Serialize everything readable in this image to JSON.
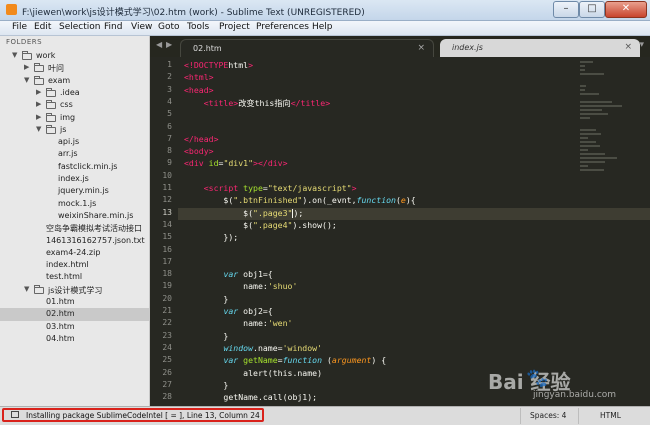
{
  "window": {
    "title": "F:\\jiewen\\work\\js设计模式学习\\02.htm (work) - Sublime Text (UNREGISTERED)",
    "min": "–",
    "max": "□",
    "close": "✕"
  },
  "menu": [
    "File",
    "Edit",
    "Selection",
    "Find",
    "View",
    "Goto",
    "Tools",
    "Project",
    "Preferences",
    "Help"
  ],
  "sidebar": {
    "header": "FOLDERS",
    "items": [
      {
        "label": "work",
        "type": "folder",
        "open": true,
        "depth": 0
      },
      {
        "label": "叶问",
        "type": "folder",
        "open": false,
        "depth": 1
      },
      {
        "label": "exam",
        "type": "folder",
        "open": true,
        "depth": 1
      },
      {
        "label": ".idea",
        "type": "folder",
        "open": false,
        "depth": 2
      },
      {
        "label": "css",
        "type": "folder",
        "open": false,
        "depth": 2
      },
      {
        "label": "img",
        "type": "folder",
        "open": false,
        "depth": 2
      },
      {
        "label": "js",
        "type": "folder",
        "open": true,
        "depth": 2
      },
      {
        "label": "api.js",
        "type": "file",
        "depth": 3
      },
      {
        "label": "arr.js",
        "type": "file",
        "depth": 3
      },
      {
        "label": "fastclick.min.js",
        "type": "file",
        "depth": 3
      },
      {
        "label": "index.js",
        "type": "file",
        "depth": 3
      },
      {
        "label": "jquery.min.js",
        "type": "file",
        "depth": 3
      },
      {
        "label": "mock.1.js",
        "type": "file",
        "depth": 3
      },
      {
        "label": "weixinShare.min.js",
        "type": "file",
        "depth": 3
      },
      {
        "label": "空岛争霸模拟考试活动接口",
        "type": "file",
        "depth": 2
      },
      {
        "label": "1461316162757.json.txt",
        "type": "file",
        "depth": 2
      },
      {
        "label": "exam4-24.zip",
        "type": "file",
        "depth": 2
      },
      {
        "label": "index.html",
        "type": "file",
        "depth": 2
      },
      {
        "label": "test.html",
        "type": "file",
        "depth": 2
      },
      {
        "label": "js设计模式学习",
        "type": "folder",
        "open": true,
        "depth": 1
      },
      {
        "label": "01.htm",
        "type": "file",
        "depth": 2
      },
      {
        "label": "02.htm",
        "type": "file",
        "depth": 2,
        "selected": true
      },
      {
        "label": "03.htm",
        "type": "file",
        "depth": 2
      },
      {
        "label": "04.htm",
        "type": "file",
        "depth": 2
      }
    ]
  },
  "tabs": [
    {
      "label": "02.htm",
      "active": true,
      "close": "×"
    },
    {
      "label": "index.js",
      "active": false,
      "close": "×"
    }
  ],
  "tab_nav": {
    "left": "◀",
    "right": "▶",
    "menu": "▾"
  },
  "editor": {
    "current_line": 13,
    "lines": [
      [
        [
          "k-tag",
          "<!DOCTYPE"
        ],
        [
          "",
          "html"
        ],
        [
          "k-tag",
          ">"
        ]
      ],
      [
        [
          "k-tag",
          "<html>"
        ]
      ],
      [
        [
          "k-tag",
          "<head>"
        ]
      ],
      [
        [
          "",
          "    "
        ],
        [
          "k-tag",
          "<title>"
        ],
        [
          "",
          "改变this指向"
        ],
        [
          "k-tag",
          "</title>"
        ]
      ],
      [],
      [],
      [
        [
          "k-tag",
          "</head>"
        ]
      ],
      [
        [
          "k-tag",
          "<body>"
        ]
      ],
      [
        [
          "k-tag",
          "<div "
        ],
        [
          "k-attr",
          "id"
        ],
        [
          "",
          "="
        ],
        [
          "k-str",
          "\"div1\""
        ],
        [
          "k-tag",
          "></div>"
        ]
      ],
      [],
      [
        [
          "",
          "    "
        ],
        [
          "k-tag",
          "<script "
        ],
        [
          "k-attr",
          "type"
        ],
        [
          "",
          "="
        ],
        [
          "k-str",
          "\"text/javascript\""
        ],
        [
          "k-tag",
          ">"
        ]
      ],
      [
        [
          "",
          "        $("
        ],
        [
          "k-str",
          "\".btnFinished\""
        ],
        [
          "",
          ").on(_evnt,"
        ],
        [
          "k-kw",
          "function"
        ],
        [
          "",
          "("
        ],
        [
          "k-var",
          "e"
        ],
        [
          "",
          "){"
        ]
      ],
      [
        [
          "",
          "            $("
        ],
        [
          "k-str",
          "\".page3\""
        ],
        [
          "",
          ");"
        ]
      ],
      [
        [
          "",
          "            $("
        ],
        [
          "k-str",
          "\".page4\""
        ],
        [
          "",
          ").show();"
        ]
      ],
      [
        [
          "",
          "        });"
        ]
      ],
      [],
      [],
      [
        [
          "",
          "        "
        ],
        [
          "k-kw",
          "var "
        ],
        [
          "",
          "obj1={"
        ]
      ],
      [
        [
          "",
          "            name:"
        ],
        [
          "k-str",
          "'shuo'"
        ]
      ],
      [
        [
          "",
          "        }"
        ]
      ],
      [
        [
          "",
          "        "
        ],
        [
          "k-kw",
          "var "
        ],
        [
          "",
          "obj2={"
        ]
      ],
      [
        [
          "",
          "            name:"
        ],
        [
          "k-str",
          "'wen'"
        ]
      ],
      [
        [
          "",
          "        }"
        ]
      ],
      [
        [
          "",
          "        "
        ],
        [
          "k-kw",
          "window"
        ],
        [
          "",
          ".name="
        ],
        [
          "k-str",
          "'window'"
        ]
      ],
      [
        [
          "",
          "        "
        ],
        [
          "k-kw",
          "var "
        ],
        [
          "k-fn",
          "getName"
        ],
        [
          "",
          "="
        ],
        [
          "k-kw",
          "function "
        ],
        [
          "",
          "("
        ],
        [
          "k-var",
          "argument"
        ],
        [
          "",
          ") {"
        ]
      ],
      [
        [
          "",
          "            alert(this.name)"
        ]
      ],
      [
        [
          "",
          "        }"
        ]
      ],
      [
        [
          "",
          "        getName.call(obj1);"
        ]
      ]
    ]
  },
  "status": {
    "message": "Installing package SublimeCodeIntel [   =  ], Line 13, Column 24",
    "spaces": "Spaces: 4",
    "syntax": "HTML"
  },
  "watermark": {
    "brand": "Bai  经验",
    "url": "jingyan.baidu.com"
  }
}
